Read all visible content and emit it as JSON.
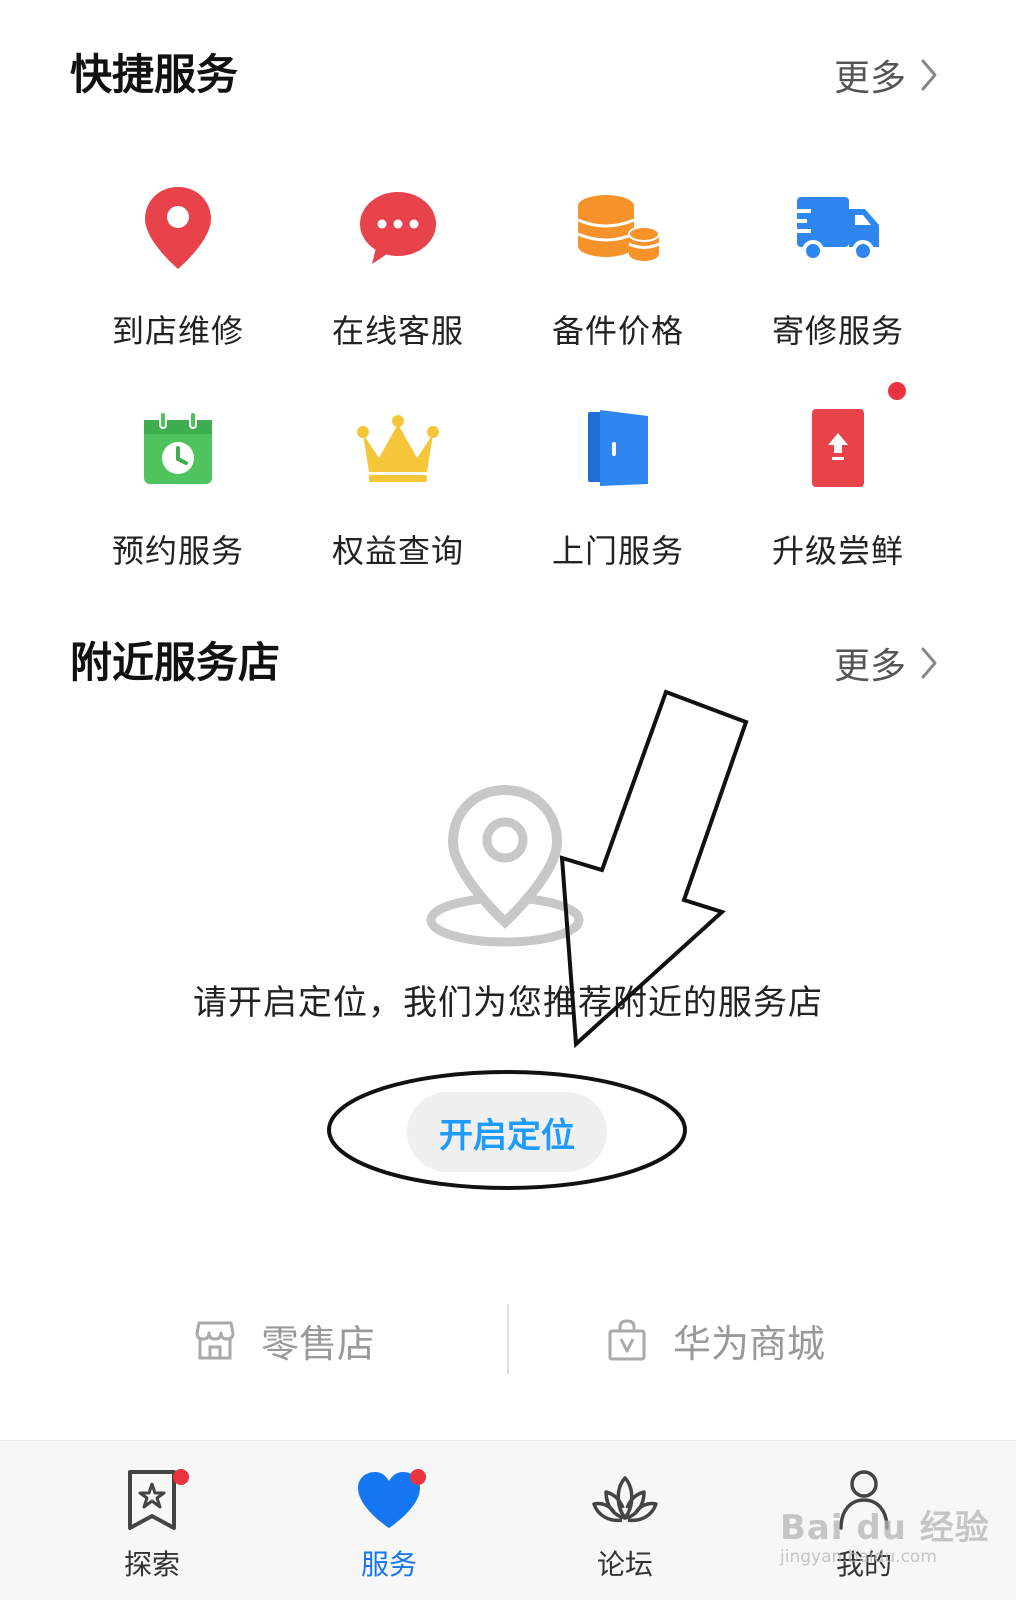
{
  "quick_services": {
    "title": "快捷服务",
    "more_label": "更多",
    "items": [
      {
        "label": "到店维修",
        "icon": "location-pin-icon",
        "color": "#e8434b"
      },
      {
        "label": "在线客服",
        "icon": "chat-bubble-icon",
        "color": "#e8434b"
      },
      {
        "label": "备件价格",
        "icon": "coins-icon",
        "color": "#f5922a"
      },
      {
        "label": "寄修服务",
        "icon": "delivery-truck-icon",
        "color": "#2f86f0"
      },
      {
        "label": "预约服务",
        "icon": "calendar-clock-icon",
        "color": "#4fc35e"
      },
      {
        "label": "权益查询",
        "icon": "crown-icon",
        "color": "#f5c53a"
      },
      {
        "label": "上门服务",
        "icon": "door-icon",
        "color": "#2f86f0"
      },
      {
        "label": "升级尝鲜",
        "icon": "upgrade-phone-icon",
        "color": "#e8434b"
      }
    ]
  },
  "nearby_stores": {
    "title": "附近服务店",
    "more_label": "更多",
    "empty_message": "请开启定位，我们为您推荐附近的服务店",
    "enable_location_label": "开启定位"
  },
  "shops": {
    "retail_label": "零售店",
    "mall_label": "华为商城"
  },
  "tabbar": {
    "tabs": [
      {
        "label": "探索",
        "icon": "bookmark-star-icon",
        "active": false,
        "badge": true
      },
      {
        "label": "服务",
        "icon": "heart-icon",
        "active": true,
        "badge": true
      },
      {
        "label": "论坛",
        "icon": "lotus-icon",
        "active": false,
        "badge": false
      },
      {
        "label": "我的",
        "icon": "person-icon",
        "active": false,
        "badge": false
      }
    ]
  },
  "watermark": {
    "main": "Bai du 经验",
    "sub": "jingyan.baidu.com"
  },
  "colors": {
    "accent_blue": "#1576f1",
    "button_text": "#1e9bff",
    "badge_red": "#e8343f"
  }
}
